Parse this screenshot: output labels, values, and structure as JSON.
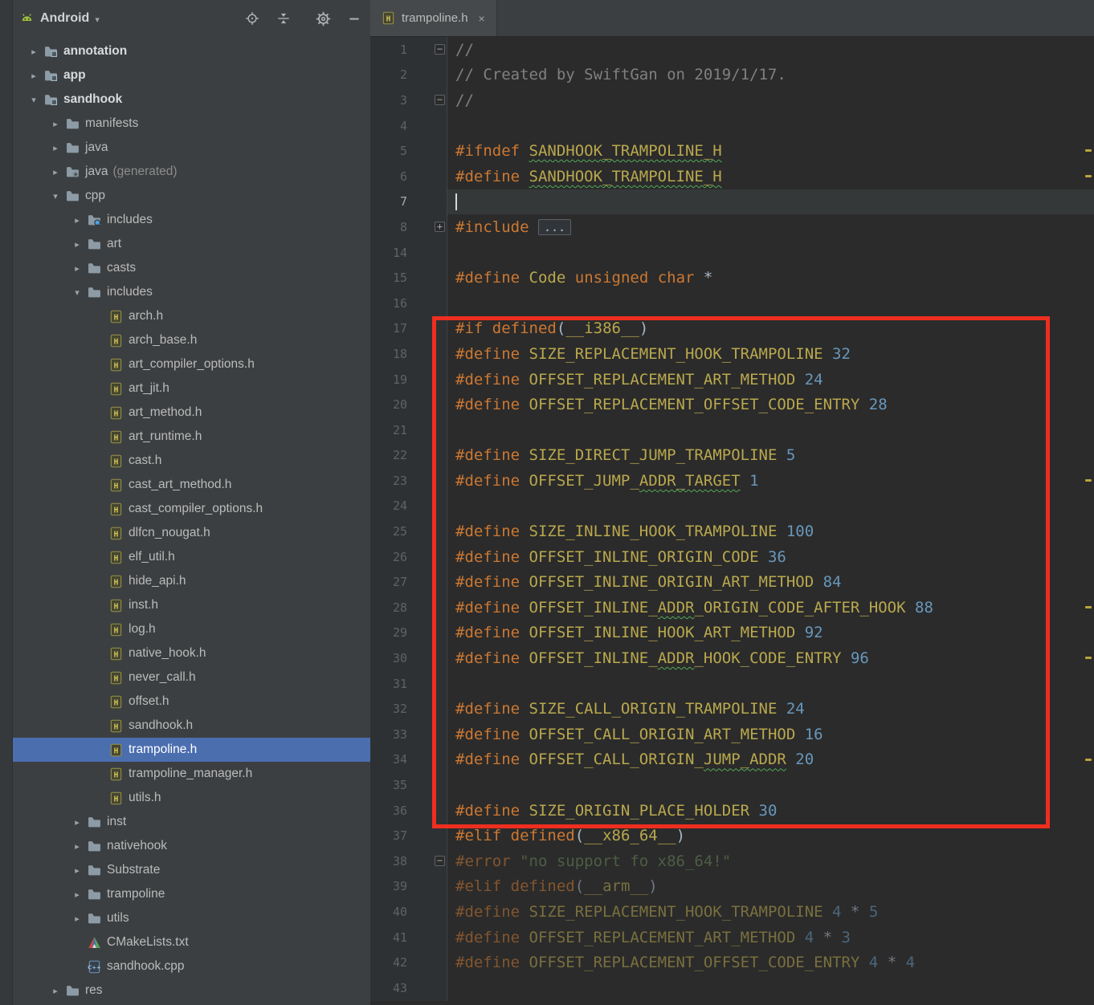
{
  "theme": {
    "sidebar_bg": "#3c3f41",
    "editor_bg": "#2b2b2b",
    "selection_blue": "#4b6eaf",
    "keyword_color": "#cc7832",
    "macro_color": "#b9a84e",
    "number_color": "#6897bb",
    "comment_color": "#808080",
    "string_color": "#6a8759",
    "annotation_red": "#ee2e1f"
  },
  "sidebar": {
    "selector": {
      "label": "Android",
      "icon": "android-icon",
      "caret_icon": "chevron-down-icon"
    },
    "toolbar_icons": [
      "locate-icon",
      "collapse-all-icon",
      "settings-icon",
      "hide-icon"
    ],
    "tree": [
      {
        "label": "annotation",
        "indent": 0,
        "chevron": "collapsed",
        "icon": "module-folder",
        "bold": true
      },
      {
        "label": "app",
        "indent": 0,
        "chevron": "collapsed",
        "icon": "module-folder",
        "bold": true
      },
      {
        "label": "sandhook",
        "indent": 0,
        "chevron": "expanded",
        "icon": "module-folder",
        "bold": true
      },
      {
        "label": "manifests",
        "indent": 1,
        "chevron": "collapsed",
        "icon": "folder"
      },
      {
        "label": "java",
        "indent": 1,
        "chevron": "collapsed",
        "icon": "folder"
      },
      {
        "label": "java",
        "suffix": "(generated)",
        "indent": 1,
        "chevron": "collapsed",
        "icon": "folder-gear"
      },
      {
        "label": "cpp",
        "indent": 1,
        "chevron": "expanded",
        "icon": "folder"
      },
      {
        "label": "includes",
        "indent": 2,
        "chevron": "collapsed",
        "icon": "folder-dot"
      },
      {
        "label": "art",
        "indent": 2,
        "chevron": "collapsed",
        "icon": "folder"
      },
      {
        "label": "casts",
        "indent": 2,
        "chevron": "collapsed",
        "icon": "folder"
      },
      {
        "label": "includes",
        "indent": 2,
        "chevron": "expanded",
        "icon": "folder"
      },
      {
        "label": "arch.h",
        "indent": 3,
        "icon": "h-file"
      },
      {
        "label": "arch_base.h",
        "indent": 3,
        "icon": "h-file"
      },
      {
        "label": "art_compiler_options.h",
        "indent": 3,
        "icon": "h-file"
      },
      {
        "label": "art_jit.h",
        "indent": 3,
        "icon": "h-file"
      },
      {
        "label": "art_method.h",
        "indent": 3,
        "icon": "h-file"
      },
      {
        "label": "art_runtime.h",
        "indent": 3,
        "icon": "h-file"
      },
      {
        "label": "cast.h",
        "indent": 3,
        "icon": "h-file"
      },
      {
        "label": "cast_art_method.h",
        "indent": 3,
        "icon": "h-file"
      },
      {
        "label": "cast_compiler_options.h",
        "indent": 3,
        "icon": "h-file"
      },
      {
        "label": "dlfcn_nougat.h",
        "indent": 3,
        "icon": "h-file"
      },
      {
        "label": "elf_util.h",
        "indent": 3,
        "icon": "h-file"
      },
      {
        "label": "hide_api.h",
        "indent": 3,
        "icon": "h-file"
      },
      {
        "label": "inst.h",
        "indent": 3,
        "icon": "h-file"
      },
      {
        "label": "log.h",
        "indent": 3,
        "icon": "h-file"
      },
      {
        "label": "native_hook.h",
        "indent": 3,
        "icon": "h-file"
      },
      {
        "label": "never_call.h",
        "indent": 3,
        "icon": "h-file"
      },
      {
        "label": "offset.h",
        "indent": 3,
        "icon": "h-file"
      },
      {
        "label": "sandhook.h",
        "indent": 3,
        "icon": "h-file"
      },
      {
        "label": "trampoline.h",
        "indent": 3,
        "icon": "h-file",
        "selected": true
      },
      {
        "label": "trampoline_manager.h",
        "indent": 3,
        "icon": "h-file"
      },
      {
        "label": "utils.h",
        "indent": 3,
        "icon": "h-file"
      },
      {
        "label": "inst",
        "indent": 2,
        "chevron": "collapsed",
        "icon": "folder"
      },
      {
        "label": "nativehook",
        "indent": 2,
        "chevron": "collapsed",
        "icon": "folder"
      },
      {
        "label": "Substrate",
        "indent": 2,
        "chevron": "collapsed",
        "icon": "folder"
      },
      {
        "label": "trampoline",
        "indent": 2,
        "chevron": "collapsed",
        "icon": "folder"
      },
      {
        "label": "utils",
        "indent": 2,
        "chevron": "collapsed",
        "icon": "folder"
      },
      {
        "label": "CMakeLists.txt",
        "indent": 2,
        "icon": "cmake"
      },
      {
        "label": "sandhook.cpp",
        "indent": 2,
        "icon": "cpp-file"
      },
      {
        "label": "res",
        "indent": 1,
        "chevron": "collapsed",
        "icon": "folder"
      }
    ]
  },
  "editor": {
    "tab": {
      "icon": "h-file",
      "title": "trampoline.h",
      "close_glyph": "×"
    },
    "stripe_marks_lines": [
      "5",
      "6",
      "23",
      "28",
      "30",
      "34"
    ],
    "lines": [
      {
        "num": "1",
        "fold": "minus",
        "tokens": [
          [
            "comment",
            "//"
          ]
        ]
      },
      {
        "num": "2",
        "tokens": [
          [
            "comment",
            "// Created by SwiftGan on 2019/1/17."
          ]
        ]
      },
      {
        "num": "3",
        "fold": "minus",
        "tokens": [
          [
            "comment",
            "//"
          ]
        ]
      },
      {
        "num": "4",
        "tokens": []
      },
      {
        "num": "5",
        "tokens": [
          [
            "kw",
            "#ifndef"
          ],
          [
            "plain",
            " "
          ],
          [
            "macro typo",
            "SANDHOOK_TRAMPOLINE_H"
          ]
        ]
      },
      {
        "num": "6",
        "tokens": [
          [
            "kw",
            "#define"
          ],
          [
            "plain",
            " "
          ],
          [
            "macro typo",
            "SANDHOOK_TRAMPOLINE_H"
          ]
        ]
      },
      {
        "num": "7",
        "caret": true,
        "tokens": []
      },
      {
        "num": "8",
        "fold": "plus",
        "tokens": [
          [
            "kw",
            "#include"
          ],
          [
            "plain",
            " "
          ],
          [
            "folded",
            "..."
          ]
        ]
      },
      {
        "num": "14",
        "tokens": []
      },
      {
        "num": "15",
        "tokens": [
          [
            "kw",
            "#define"
          ],
          [
            "plain",
            " "
          ],
          [
            "macro",
            "Code"
          ],
          [
            "plain",
            " "
          ],
          [
            "kw",
            "unsigned"
          ],
          [
            "plain",
            " "
          ],
          [
            "kw",
            "char"
          ],
          [
            "plain",
            " *"
          ]
        ]
      },
      {
        "num": "16",
        "tokens": []
      },
      {
        "num": "17",
        "tokens": [
          [
            "kw",
            "#if"
          ],
          [
            "plain",
            " "
          ],
          [
            "kw",
            "defined"
          ],
          [
            "plain",
            "("
          ],
          [
            "macro",
            "__i386__"
          ],
          [
            "plain",
            ")"
          ]
        ]
      },
      {
        "num": "18",
        "tokens": [
          [
            "kw",
            "#define"
          ],
          [
            "plain",
            " "
          ],
          [
            "macro",
            "SIZE_REPLACEMENT_HOOK_TRAMPOLINE"
          ],
          [
            "plain",
            " "
          ],
          [
            "num",
            "32"
          ]
        ]
      },
      {
        "num": "19",
        "tokens": [
          [
            "kw",
            "#define"
          ],
          [
            "plain",
            " "
          ],
          [
            "macro",
            "OFFSET_REPLACEMENT_ART_METHOD"
          ],
          [
            "plain",
            " "
          ],
          [
            "num",
            "24"
          ]
        ]
      },
      {
        "num": "20",
        "tokens": [
          [
            "kw",
            "#define"
          ],
          [
            "plain",
            " "
          ],
          [
            "macro",
            "OFFSET_REPLACEMENT_OFFSET_CODE_ENTRY"
          ],
          [
            "plain",
            " "
          ],
          [
            "num",
            "28"
          ]
        ]
      },
      {
        "num": "21",
        "tokens": []
      },
      {
        "num": "22",
        "tokens": [
          [
            "kw",
            "#define"
          ],
          [
            "plain",
            " "
          ],
          [
            "macro",
            "SIZE_DIRECT_JUMP_TRAMPOLINE"
          ],
          [
            "plain",
            " "
          ],
          [
            "num",
            "5"
          ]
        ]
      },
      {
        "num": "23",
        "tokens": [
          [
            "kw",
            "#define"
          ],
          [
            "plain",
            " "
          ],
          [
            "macro",
            "OFFSET_JUMP_"
          ],
          [
            "macro typo",
            "ADDR_TARGET"
          ],
          [
            "plain",
            " "
          ],
          [
            "num",
            "1"
          ]
        ]
      },
      {
        "num": "24",
        "tokens": []
      },
      {
        "num": "25",
        "tokens": [
          [
            "kw",
            "#define"
          ],
          [
            "plain",
            " "
          ],
          [
            "macro",
            "SIZE_INLINE_HOOK_TRAMPOLINE"
          ],
          [
            "plain",
            " "
          ],
          [
            "num",
            "100"
          ]
        ]
      },
      {
        "num": "26",
        "tokens": [
          [
            "kw",
            "#define"
          ],
          [
            "plain",
            " "
          ],
          [
            "macro",
            "OFFSET_INLINE_ORIGIN_CODE"
          ],
          [
            "plain",
            " "
          ],
          [
            "num",
            "36"
          ]
        ]
      },
      {
        "num": "27",
        "tokens": [
          [
            "kw",
            "#define"
          ],
          [
            "plain",
            " "
          ],
          [
            "macro",
            "OFFSET_INLINE_ORIGIN_ART_METHOD"
          ],
          [
            "plain",
            " "
          ],
          [
            "num",
            "84"
          ]
        ]
      },
      {
        "num": "28",
        "tokens": [
          [
            "kw",
            "#define"
          ],
          [
            "plain",
            " "
          ],
          [
            "macro",
            "OFFSET_INLINE_"
          ],
          [
            "macro typo",
            "ADDR"
          ],
          [
            "macro",
            "_ORIGIN_CODE_AFTER_HOOK"
          ],
          [
            "plain",
            " "
          ],
          [
            "num",
            "88"
          ]
        ]
      },
      {
        "num": "29",
        "tokens": [
          [
            "kw",
            "#define"
          ],
          [
            "plain",
            " "
          ],
          [
            "macro",
            "OFFSET_INLINE_HOOK_ART_METHOD"
          ],
          [
            "plain",
            " "
          ],
          [
            "num",
            "92"
          ]
        ]
      },
      {
        "num": "30",
        "tokens": [
          [
            "kw",
            "#define"
          ],
          [
            "plain",
            " "
          ],
          [
            "macro",
            "OFFSET_INLINE_"
          ],
          [
            "macro typo",
            "ADDR"
          ],
          [
            "macro",
            "_HOOK_CODE_ENTRY"
          ],
          [
            "plain",
            " "
          ],
          [
            "num",
            "96"
          ]
        ]
      },
      {
        "num": "31",
        "tokens": []
      },
      {
        "num": "32",
        "tokens": [
          [
            "kw",
            "#define"
          ],
          [
            "plain",
            " "
          ],
          [
            "macro",
            "SIZE_CALL_ORIGIN_TRAMPOLINE"
          ],
          [
            "plain",
            " "
          ],
          [
            "num",
            "24"
          ]
        ]
      },
      {
        "num": "33",
        "tokens": [
          [
            "kw",
            "#define"
          ],
          [
            "plain",
            " "
          ],
          [
            "macro",
            "OFFSET_CALL_ORIGIN_ART_METHOD"
          ],
          [
            "plain",
            " "
          ],
          [
            "num",
            "16"
          ]
        ]
      },
      {
        "num": "34",
        "tokens": [
          [
            "kw",
            "#define"
          ],
          [
            "plain",
            " "
          ],
          [
            "macro",
            "OFFSET_CALL_ORIGIN_"
          ],
          [
            "macro typo",
            "JUMP_ADDR"
          ],
          [
            "plain",
            " "
          ],
          [
            "num",
            "20"
          ]
        ]
      },
      {
        "num": "35",
        "tokens": []
      },
      {
        "num": "36",
        "tokens": [
          [
            "kw",
            "#define"
          ],
          [
            "plain",
            " "
          ],
          [
            "macro",
            "SIZE_ORIGIN_PLACE_HOLDER"
          ],
          [
            "plain",
            " "
          ],
          [
            "num",
            "30"
          ]
        ]
      },
      {
        "num": "37",
        "tokens": [
          [
            "kw",
            "#elif"
          ],
          [
            "plain",
            " "
          ],
          [
            "kw",
            "defined"
          ],
          [
            "plain",
            "("
          ],
          [
            "macro",
            "__x86_64__"
          ],
          [
            "plain",
            ")"
          ]
        ]
      },
      {
        "num": "38",
        "fold": "minus",
        "dim": true,
        "tokens": [
          [
            "kw",
            "#error"
          ],
          [
            "plain",
            " "
          ],
          [
            "str",
            "\"no support fo x86_64!\""
          ]
        ]
      },
      {
        "num": "39",
        "dim": true,
        "tokens": [
          [
            "kw",
            "#elif"
          ],
          [
            "plain",
            " "
          ],
          [
            "kw",
            "defined"
          ],
          [
            "plain",
            "("
          ],
          [
            "macro",
            "__arm__"
          ],
          [
            "plain",
            ")"
          ]
        ]
      },
      {
        "num": "40",
        "dim": true,
        "tokens": [
          [
            "kw",
            "#define"
          ],
          [
            "plain",
            " "
          ],
          [
            "macro",
            "SIZE_REPLACEMENT_HOOK_TRAMPOLINE"
          ],
          [
            "plain",
            " "
          ],
          [
            "num",
            "4"
          ],
          [
            "plain",
            " * "
          ],
          [
            "num",
            "5"
          ]
        ]
      },
      {
        "num": "41",
        "dim": true,
        "tokens": [
          [
            "kw",
            "#define"
          ],
          [
            "plain",
            " "
          ],
          [
            "macro",
            "OFFSET_REPLACEMENT_ART_METHOD"
          ],
          [
            "plain",
            " "
          ],
          [
            "num",
            "4"
          ],
          [
            "plain",
            " * "
          ],
          [
            "num",
            "3"
          ]
        ]
      },
      {
        "num": "42",
        "dim": true,
        "tokens": [
          [
            "kw",
            "#define"
          ],
          [
            "plain",
            " "
          ],
          [
            "macro",
            "OFFSET_REPLACEMENT_OFFSET_CODE_ENTRY"
          ],
          [
            "plain",
            " "
          ],
          [
            "num",
            "4"
          ],
          [
            "plain",
            " * "
          ],
          [
            "num",
            "4"
          ]
        ]
      },
      {
        "num": "43",
        "tokens": []
      }
    ]
  },
  "annotation": {
    "type": "red-box"
  }
}
